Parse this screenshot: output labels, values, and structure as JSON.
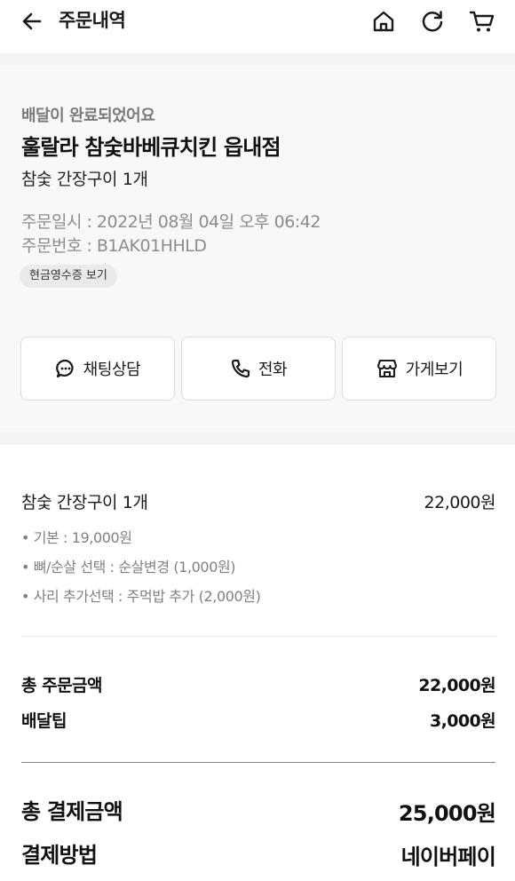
{
  "header": {
    "title": "주문내역"
  },
  "order": {
    "status": "배달이 완료되었어요",
    "store_name": "훌랄라 참숯바베큐치킨 읍내점",
    "menu_summary": "참숯 간장구이 1개",
    "order_date": "주문일시 : 2022년 08월 04일 오후 06:42",
    "order_number": "주문번호 : B1AK01HHLD",
    "receipt_button": "현금영수증 보기"
  },
  "actions": {
    "chat": "채팅상담",
    "call": "전화",
    "store": "가게보기"
  },
  "item": {
    "name": "참숯 간장구이 1개",
    "price": "22,000원",
    "options": [
      "• 기본 : 19,000원",
      "• 뼈/순살 선택 : 순살변경 (1,000원)",
      "• 사리 추가선택 : 주먹밥 추가 (2,000원)"
    ]
  },
  "summary": {
    "total_order_label": "총 주문금액",
    "total_order_value": "22,000원",
    "delivery_tip_label": "배달팁",
    "delivery_tip_value": "3,000원",
    "total_payment_label": "총 결제금액",
    "total_payment_value": "25,000원",
    "payment_method_label": "결제방법",
    "payment_method_value": "네이버페이"
  },
  "colors": {
    "background": "#ffffff",
    "card_background": "#f8f8f9",
    "separator_band": "#f2f3f5",
    "muted_text": "#8c8c8c"
  }
}
